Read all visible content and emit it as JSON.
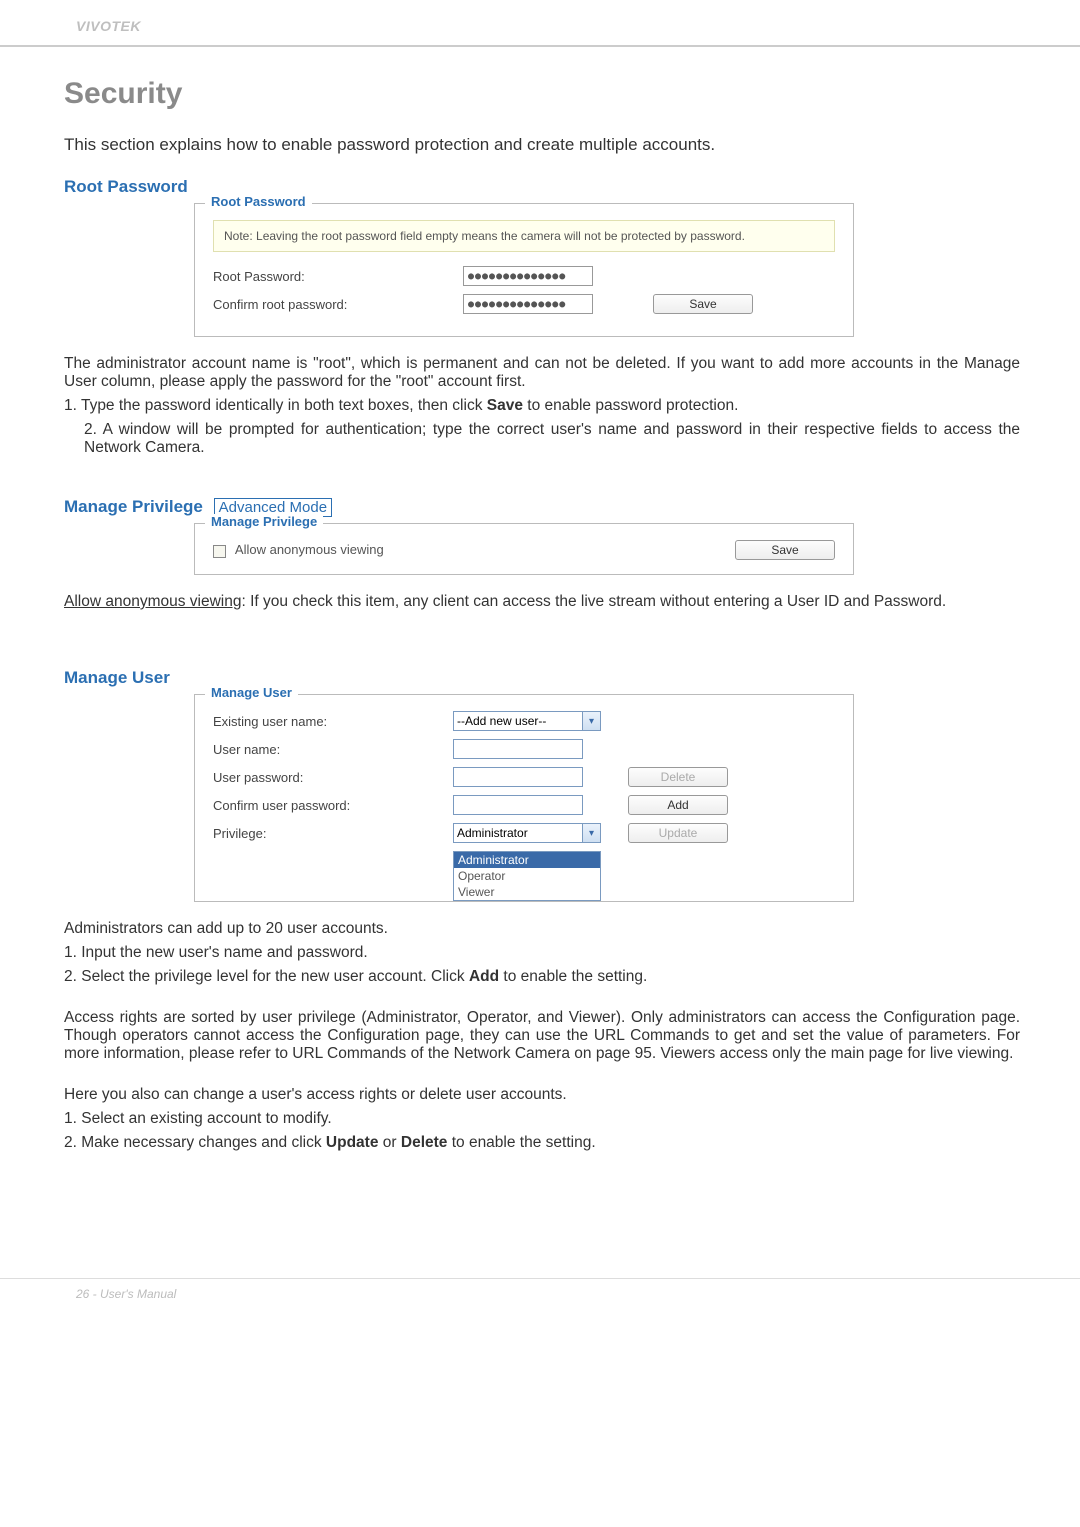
{
  "header": {
    "brand": "VIVOTEK"
  },
  "title": "Security",
  "intro": "This section explains how to enable password protection and create multiple accounts.",
  "root_password": {
    "heading": "Root Password",
    "legend": "Root Password",
    "note": "Note: Leaving the root password field empty means the camera will not be protected by password.",
    "label_root": "Root Password:",
    "label_confirm": "Confirm root password:",
    "dots": "●●●●●●●●●●●●●●",
    "save": "Save",
    "explain_pre": "The administrator account name is \"root\", which is permanent and can not be deleted. If you want to add more accounts in the Manage User column, please apply the password for the \"root\" account first.",
    "step1_pre": "1. Type the password identically in both text boxes, then click ",
    "step1_bold": "Save",
    "step1_post": " to enable password protection.",
    "step2": "2. A window will be prompted for authentication; type the correct user's name and password in their respective fields to access the Network Camera."
  },
  "manage_privilege": {
    "heading": "Manage Privilege",
    "advmode": "Advanced Mode",
    "legend": "Manage Privilege",
    "checkbox_label": "Allow anonymous viewing",
    "save": "Save",
    "explain_underline": "Allow anonymous viewing",
    "explain_rest": ": If you check this item, any client can access the live stream without entering a User ID and Password."
  },
  "manage_user": {
    "heading": "Manage User",
    "legend": "Manage User",
    "labels": {
      "existing": "Existing user name:",
      "username": "User name:",
      "password": "User password:",
      "confirm": "Confirm user password:",
      "privilege": "Privilege:"
    },
    "existing_value": "--Add new user--",
    "privilege_value": "Administrator",
    "options": [
      "Administrator",
      "Operator",
      "Viewer"
    ],
    "buttons": {
      "delete": "Delete",
      "add": "Add",
      "update": "Update"
    },
    "p_intro": "Administrators can add up to 20 user accounts.",
    "p_step1": "1. Input the new user's name and password.",
    "p_step2_pre": "2. Select the privilege level for the new user account. Click ",
    "p_step2_bold": "Add",
    "p_step2_post": " to enable the setting.",
    "p_rights": "Access rights are sorted by user privilege (Administrator, Operator, and Viewer). Only administrators can access the Configuration page. Though operators cannot access the Configuration page, they can use the URL Commands to get and set the value of parameters. For more information, please refer to URL Commands of the Network Camera on page 95. Viewers access only the main page for live viewing.",
    "p_modify_intro": "Here you also can change a user's access rights or delete user accounts.",
    "p_modify_1": "1. Select an existing account to modify.",
    "p_modify_2_pre": "2. Make necessary changes and click ",
    "p_modify_2_b1": "Update",
    "p_modify_2_mid": " or ",
    "p_modify_2_b2": "Delete",
    "p_modify_2_post": " to enable the setting."
  },
  "footer": "26 - User's Manual"
}
